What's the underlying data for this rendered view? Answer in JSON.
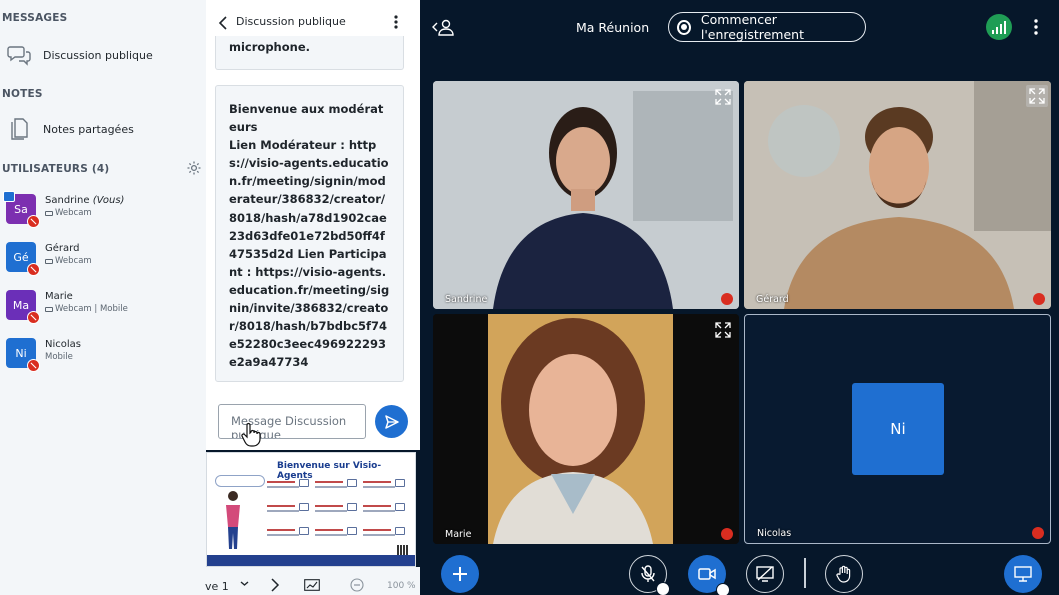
{
  "left_panel": {
    "messages_title": "MESSAGES",
    "public_chat_label": "Discussion publique",
    "notes_title": "NOTES",
    "shared_notes_label": "Notes partagées",
    "users_title": "UTILISATEURS (4)",
    "users": [
      {
        "initials": "Sa",
        "name": "Sandrine",
        "you_tag": "(Vous)",
        "sub": "Webcam",
        "color": "#7c2fb0",
        "presenter": true
      },
      {
        "initials": "Gé",
        "name": "Gérard",
        "you_tag": "",
        "sub": "Webcam",
        "color": "#1f6fd1",
        "presenter": false
      },
      {
        "initials": "Ma",
        "name": "Marie",
        "you_tag": "",
        "sub": "Webcam | Mobile",
        "color": "#6b2fb8",
        "presenter": false
      },
      {
        "initials": "Ni",
        "name": "Nicolas",
        "you_tag": "",
        "sub": "Mobile",
        "color": "#1f6fd1",
        "presenter": false
      }
    ]
  },
  "chat": {
    "title": "Discussion publique",
    "previous_message_tail": "microphone.",
    "message": "Bienvenue aux modérateurs\nLien Modérateur : https://visio-agents.education.fr/meeting/signin/moderateur/386832/creator/8018/hash/a78d1902cae23d63dfe01e72bd50ff4f47535d2d Lien Participant : https://visio-agents.education.fr/meeting/signin/invite/386832/creator/8018/hash/b7bdbc5f74e52280c3eec496922293e2a9a47734",
    "input_placeholder": "Message Discussion publique"
  },
  "presentation": {
    "title": "Bienvenue sur Visio-Agents",
    "slide_label": "ve 1",
    "zoom": "100 %"
  },
  "top_bar": {
    "meeting_title": "Ma Réunion",
    "record_label": "Commencer l'enregistrement"
  },
  "tiles": [
    {
      "name": "Sandrine"
    },
    {
      "name": "Gérard"
    },
    {
      "name": "Marie"
    },
    {
      "name": "Nicolas",
      "initials": "Ni"
    }
  ],
  "colors": {
    "accent": "#1f6fd1",
    "background": "#06172a",
    "mute": "#d92d20",
    "connection": "#1f9d55"
  }
}
